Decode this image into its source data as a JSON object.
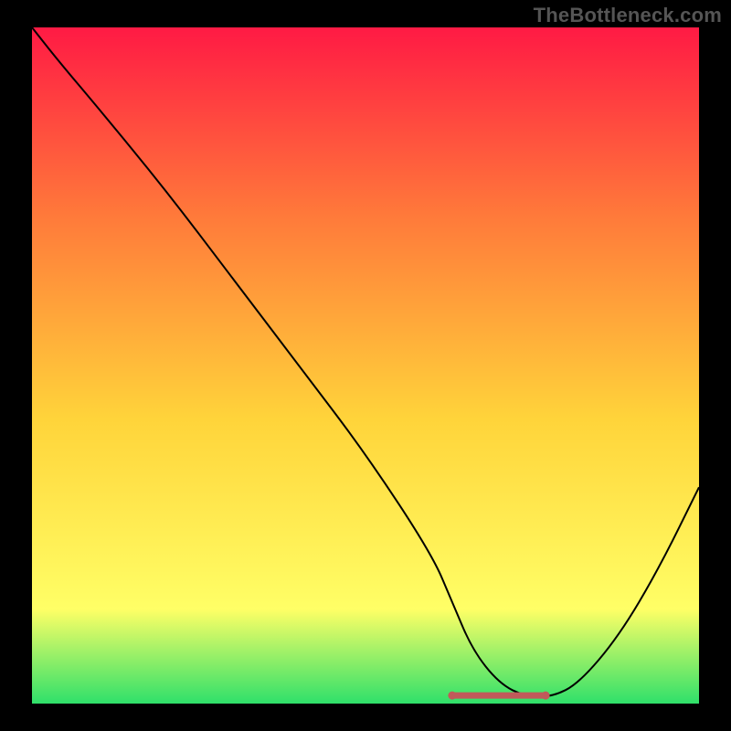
{
  "watermark": "TheBottleneck.com",
  "chart_data": {
    "type": "line",
    "title": "",
    "xlabel": "",
    "ylabel": "",
    "xlim": [
      0,
      100
    ],
    "ylim": [
      0,
      100
    ],
    "grid": false,
    "legend": false,
    "background_gradient": {
      "top": "#ff1a44",
      "mid1": "#ff7a3a",
      "mid2": "#ffd43a",
      "low": "#ffff66",
      "bottom": "#2fe06a"
    },
    "series": [
      {
        "name": "curve",
        "color": "#000000",
        "x": [
          0,
          4,
          10,
          20,
          30,
          40,
          50,
          60,
          63,
          66,
          70,
          74,
          78,
          82,
          88,
          94,
          100
        ],
        "y": [
          100,
          95,
          88,
          76,
          63,
          50,
          37,
          22,
          15,
          8,
          3,
          1,
          1,
          3,
          10,
          20,
          32
        ]
      }
    ],
    "flat_marker": {
      "name": "flat-segment",
      "color": "#c15a5a",
      "x_start": 63,
      "x_end": 77,
      "y": 1.2
    }
  }
}
